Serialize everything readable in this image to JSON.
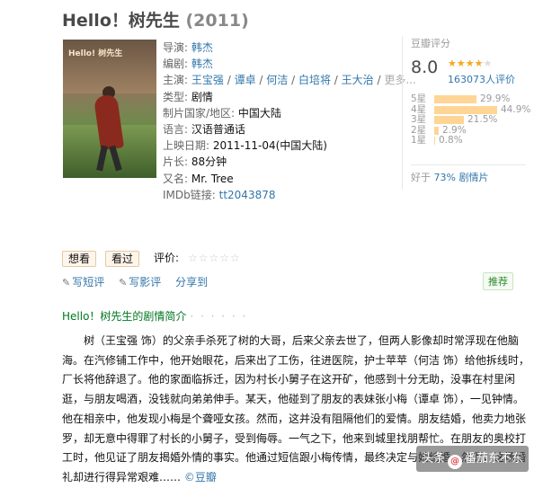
{
  "movie": {
    "title": "Hello！树先生",
    "year": "(2011)"
  },
  "poster": {
    "text": "Hello! 树先生"
  },
  "info": {
    "director_label": "导演:",
    "director": "韩杰",
    "writer_label": "编剧:",
    "writer": "韩杰",
    "cast_label": "主演:",
    "cast": [
      "王宝强",
      "谭卓",
      "何洁",
      "白培将",
      "王大治"
    ],
    "cast_more": "更多...",
    "genre_label": "类型:",
    "genre": "剧情",
    "country_label": "制片国家/地区:",
    "country": "中国大陆",
    "language_label": "语言:",
    "language": "汉语普通话",
    "release_label": "上映日期:",
    "release": "2011-11-04(中国大陆)",
    "runtime_label": "片长:",
    "runtime": "88分钟",
    "aka_label": "又名:",
    "aka": "Mr. Tree",
    "imdb_label": "IMDb链接:",
    "imdb": "tt2043878"
  },
  "rating": {
    "label": "豆瓣评分",
    "score": "8.0",
    "stars": 4,
    "votes": "163073人评价",
    "distribution": [
      {
        "star": "5星",
        "percent": "29.9%",
        "value": 29.9
      },
      {
        "star": "4星",
        "percent": "44.9%",
        "value": 44.9
      },
      {
        "star": "3星",
        "percent": "21.5%",
        "value": 21.5
      },
      {
        "star": "2星",
        "percent": "2.9%",
        "value": 2.9
      },
      {
        "star": "1星",
        "percent": "0.8%",
        "value": 0.8
      }
    ],
    "better_prefix": "好于",
    "better_link": "73% 剧情片"
  },
  "actions": {
    "want": "想看",
    "seen": "看过",
    "rate_label": "评价:",
    "rate_stars": "☆☆☆☆☆",
    "short_review": "写短评",
    "review": "写影评",
    "share": "分享到",
    "recommend": "推荐"
  },
  "summary": {
    "heading": "Hello！树先生的剧情简介",
    "dots": "· · · · · ·",
    "text": "树（王宝强 饰）的父亲手杀死了树的大哥，后来父亲去世了，但两人影像却时常浮现在他脑海。在汽修铺工作中，他开始眼花，后来出了工伤，往进医院，护士苹苹（何洁 饰）给他拆线时，厂长将他辞退了。他的家面临拆迁，因为村长小舅子在这开矿，他感到十分无助，没事在村里闲逛，与朋友喝酒，没钱就向弟弟伸手。某天，他碰到了朋友的表妹张小梅（谭卓 饰），一见钟情。他在相亲中，他发现小梅是个聋哑女孩。然而，这并没有阻隔他们的爱情。朋友结婚，他卖力地张罗，却无意中得罪了村长的小舅子，受到侮辱。一气之下，他来到城里找朋帮忙。在朋友的奥校打工时，他见证了朋友揭婚外情的事实。他通过短信跟小梅传情，最终决定与她结婚。然而，这场婚礼却进行得异常艰难……",
    "source": "©豆瓣"
  },
  "watermark": {
    "prefix": "头条",
    "at": "@",
    "name": "番茄东不东"
  }
}
